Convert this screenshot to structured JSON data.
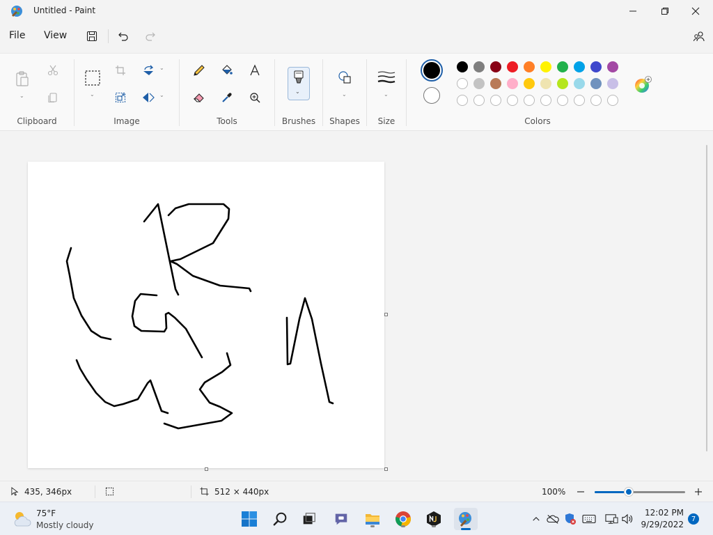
{
  "window": {
    "title": "Untitled - Paint",
    "minimize_icon": "minimize-icon",
    "maximize_icon": "restore-icon",
    "close_icon": "close-icon"
  },
  "menu": {
    "file": "File",
    "view": "View"
  },
  "ribbon": {
    "groups": {
      "clipboard": "Clipboard",
      "image": "Image",
      "tools": "Tools",
      "brushes": "Brushes",
      "shapes": "Shapes",
      "size": "Size",
      "colors": "Colors"
    }
  },
  "colors": {
    "primary": "#000000",
    "secondary": "#ffffff",
    "palette_row1": [
      "#000000",
      "#7f7f7f",
      "#880015",
      "#ed1c24",
      "#ff7f27",
      "#fff200",
      "#22b14c",
      "#00a2e8",
      "#3f48cc",
      "#a349a4"
    ],
    "palette_row2": [
      "#ffffff",
      "#c3c3c3",
      "#b97a57",
      "#ffaec9",
      "#ffc90e",
      "#efe4b0",
      "#b5e61d",
      "#99d9ea",
      "#7092be",
      "#c8bfe7"
    ],
    "palette_row3_empty": 10,
    "accent": "#0067c0"
  },
  "status": {
    "cursor_pos": "435, 346px",
    "canvas_size": "512 × 440px",
    "zoom": "100%",
    "zoom_fraction": 0.38
  },
  "taskbar": {
    "weather_temp": "75°F",
    "weather_desc": "Mostly cloudy",
    "time": "12:02 PM",
    "date": "9/29/2022",
    "notifications": "7"
  }
}
